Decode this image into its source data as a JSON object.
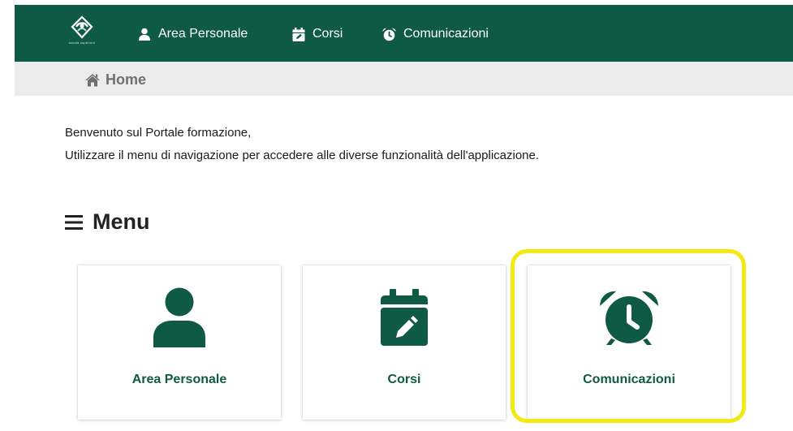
{
  "colors": {
    "brand": "#0e5a45",
    "highlight": "#f2ea10",
    "breadcrumb_bg": "#ececec"
  },
  "header": {
    "logo_alt_icon": "portal-logo",
    "logo_text": "scuola superiore",
    "nav": [
      {
        "label": "Area Personale",
        "icon": "user-icon"
      },
      {
        "label": "Corsi",
        "icon": "calendar-edit-icon"
      },
      {
        "label": "Comunicazioni",
        "icon": "alarm-clock-icon"
      }
    ]
  },
  "breadcrumb": {
    "icon": "home-icon",
    "label": "Home"
  },
  "intro": {
    "line1": "Benvenuto sul Portale formazione,",
    "line2": "Utilizzare il menu di navigazione per accedere alle diverse funzionalità dell'applicazione."
  },
  "menu": {
    "icon": "bars-icon",
    "title": "Menu",
    "cards": [
      {
        "label": "Area Personale",
        "icon": "user-icon"
      },
      {
        "label": "Corsi",
        "icon": "calendar-edit-icon"
      },
      {
        "label": "Comunicazioni",
        "icon": "alarm-clock-icon",
        "highlighted": true
      }
    ]
  }
}
